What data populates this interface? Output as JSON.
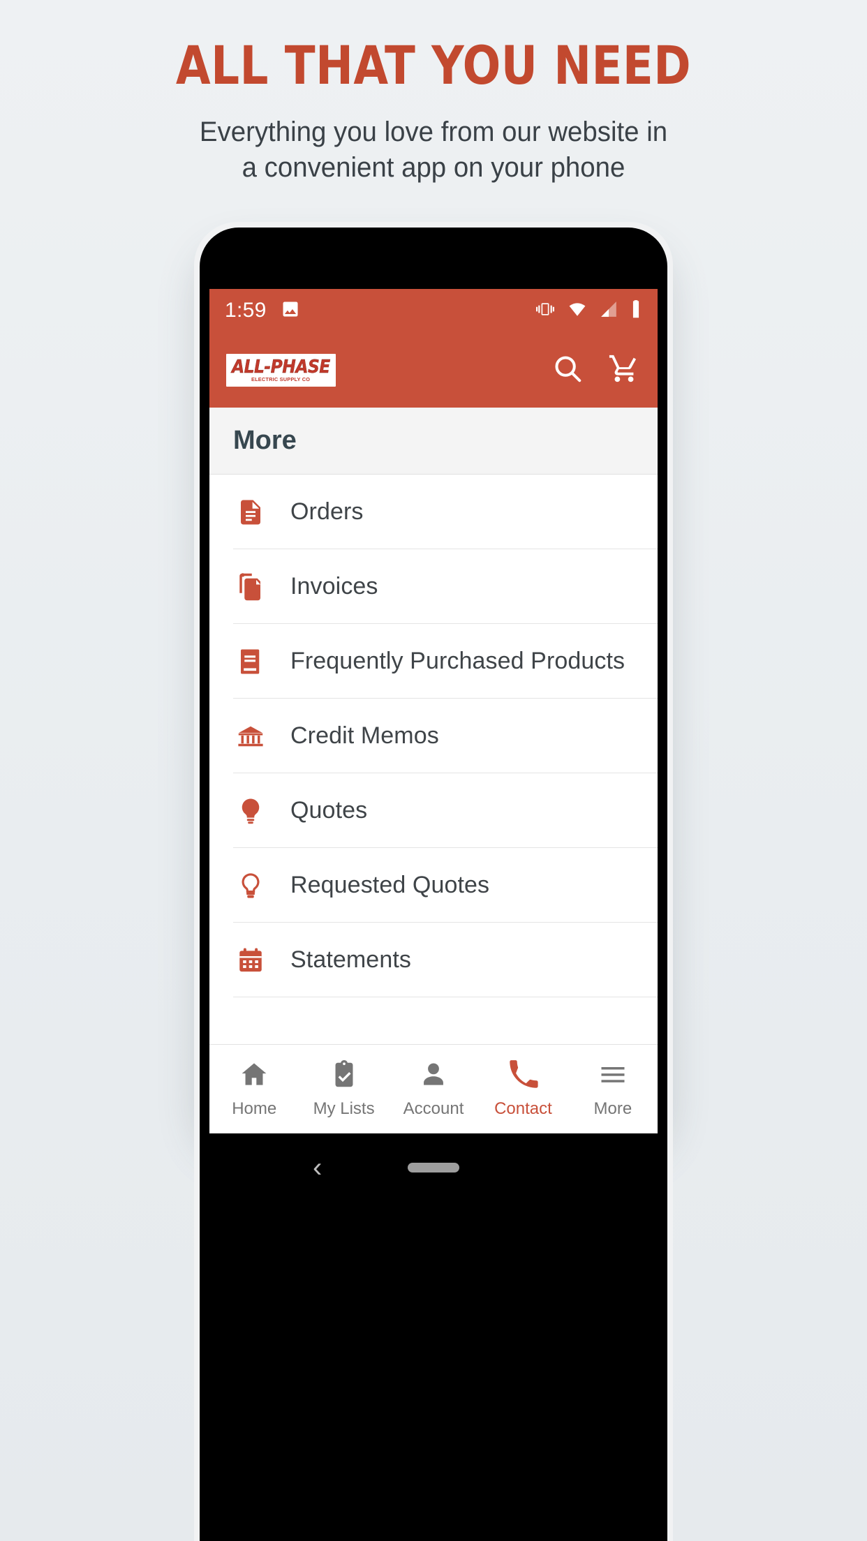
{
  "promo": {
    "title": "ALL THAT YOU NEED",
    "subtitle_line1": "Everything you love from our website in",
    "subtitle_line2": "a convenient app on your phone",
    "title_color": "#c2492f",
    "subtitle_color": "#3a4147",
    "background_color": "#eceff1"
  },
  "phone": {
    "status_bar": {
      "time": "1:59",
      "left_icons": [
        "image-icon"
      ],
      "right_icons": [
        "vibrate-icon",
        "wifi-icon",
        "signal-icon",
        "battery-icon"
      ],
      "background_color": "#c8503a"
    },
    "app_bar": {
      "logo_main": "ALL-PHASE",
      "logo_sub": "ELECTRIC SUPPLY CO",
      "actions": [
        "search-icon",
        "cart-icon"
      ],
      "background_color": "#c8503a"
    },
    "section": {
      "title": "More"
    },
    "menu_items": [
      {
        "label": "Orders",
        "icon": "document-icon"
      },
      {
        "label": "Invoices",
        "icon": "copy-documents-icon"
      },
      {
        "label": "Frequently Purchased Products",
        "icon": "book-icon"
      },
      {
        "label": "Credit Memos",
        "icon": "bank-icon"
      },
      {
        "label": "Quotes",
        "icon": "lightbulb-filled-icon"
      },
      {
        "label": "Requested Quotes",
        "icon": "lightbulb-outline-icon"
      },
      {
        "label": "Statements",
        "icon": "calendar-icon"
      }
    ],
    "bottom_nav": {
      "active": "Contact",
      "items": [
        {
          "label": "Home",
          "icon": "home-icon",
          "active": false
        },
        {
          "label": "My Lists",
          "icon": "clipboard-check-icon",
          "active": false
        },
        {
          "label": "Account",
          "icon": "person-icon",
          "active": false
        },
        {
          "label": "Contact",
          "icon": "phone-icon",
          "active": true
        },
        {
          "label": "More",
          "icon": "hamburger-icon",
          "active": false
        }
      ],
      "active_color": "#c8503a",
      "inactive_color": "#757575"
    },
    "android_nav": {
      "back_glyph": "‹"
    }
  }
}
